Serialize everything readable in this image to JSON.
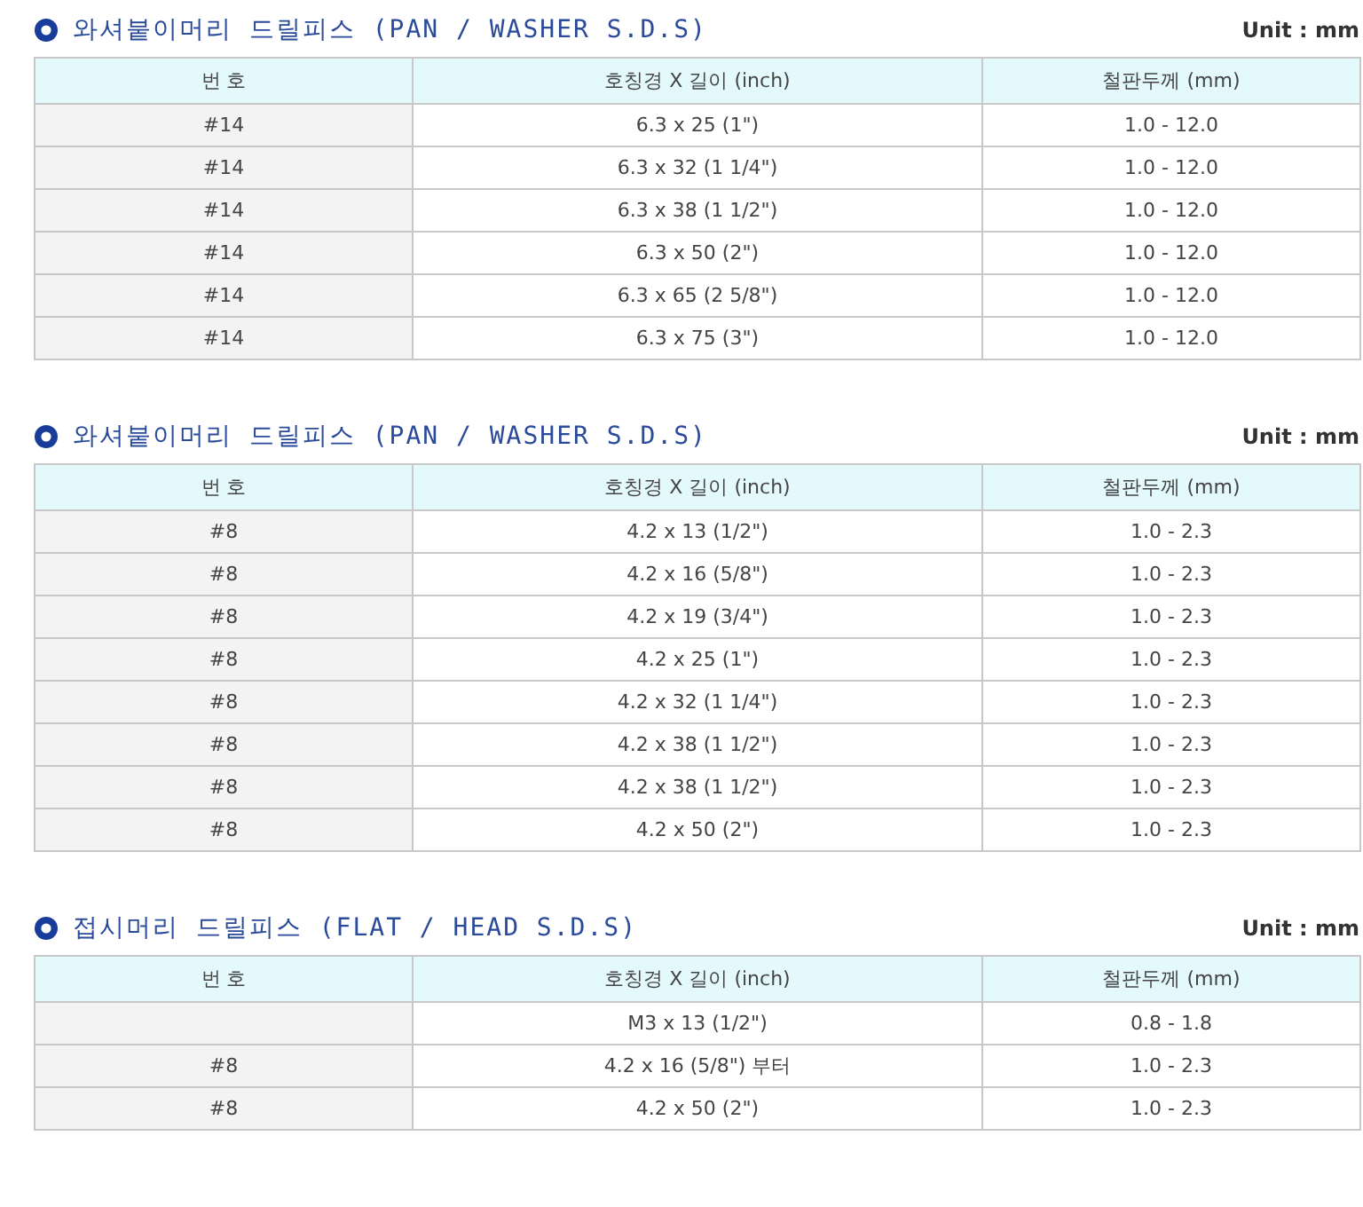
{
  "sections": [
    {
      "title": "와셔붙이머리 드릴피스 (PAN / WASHER S.D.S)",
      "unit": "Unit : mm",
      "columns": [
        "번 호",
        "호칭경 X 길이 (inch)",
        "철판두께 (mm)"
      ],
      "rows": [
        [
          "#14",
          "6.3 x 25 (1\")",
          "1.0 - 12.0"
        ],
        [
          "#14",
          "6.3 x 32 (1 1/4\")",
          "1.0 - 12.0"
        ],
        [
          "#14",
          "6.3 x 38 (1 1/2\")",
          "1.0 - 12.0"
        ],
        [
          "#14",
          "6.3 x 50 (2\")",
          "1.0 - 12.0"
        ],
        [
          "#14",
          "6.3 x 65 (2 5/8\")",
          "1.0 - 12.0"
        ],
        [
          "#14",
          "6.3 x 75 (3\")",
          "1.0 - 12.0"
        ]
      ]
    },
    {
      "title": "와셔붙이머리 드릴피스 (PAN / WASHER S.D.S)",
      "unit": "Unit : mm",
      "columns": [
        "번 호",
        "호칭경 X 길이 (inch)",
        "철판두께 (mm)"
      ],
      "rows": [
        [
          "#8",
          "4.2 x 13 (1/2\")",
          "1.0 - 2.3"
        ],
        [
          "#8",
          "4.2 x 16 (5/8\")",
          "1.0 - 2.3"
        ],
        [
          "#8",
          "4.2 x 19 (3/4\")",
          "1.0 - 2.3"
        ],
        [
          "#8",
          "4.2 x 25 (1\")",
          "1.0 - 2.3"
        ],
        [
          "#8",
          "4.2 x 32 (1 1/4\")",
          "1.0 - 2.3"
        ],
        [
          "#8",
          "4.2 x 38 (1 1/2\")",
          "1.0 - 2.3"
        ],
        [
          "#8",
          "4.2 x 38 (1 1/2\")",
          "1.0 - 2.3"
        ],
        [
          "#8",
          "4.2 x 50 (2\")",
          "1.0 - 2.3"
        ]
      ]
    },
    {
      "title": "접시머리 드릴피스 (FLAT / HEAD S.D.S)",
      "unit": "Unit : mm",
      "columns": [
        "번 호",
        "호칭경 X 길이 (inch)",
        "철판두께 (mm)"
      ],
      "rows": [
        [
          "",
          "M3 x 13 (1/2\")",
          "0.8 - 1.8"
        ],
        [
          "#8",
          "4.2 x 16 (5/8\") 부터",
          "1.0 - 2.3"
        ],
        [
          "#8",
          "4.2 x 50 (2\")",
          "1.0 - 2.3"
        ]
      ]
    }
  ]
}
